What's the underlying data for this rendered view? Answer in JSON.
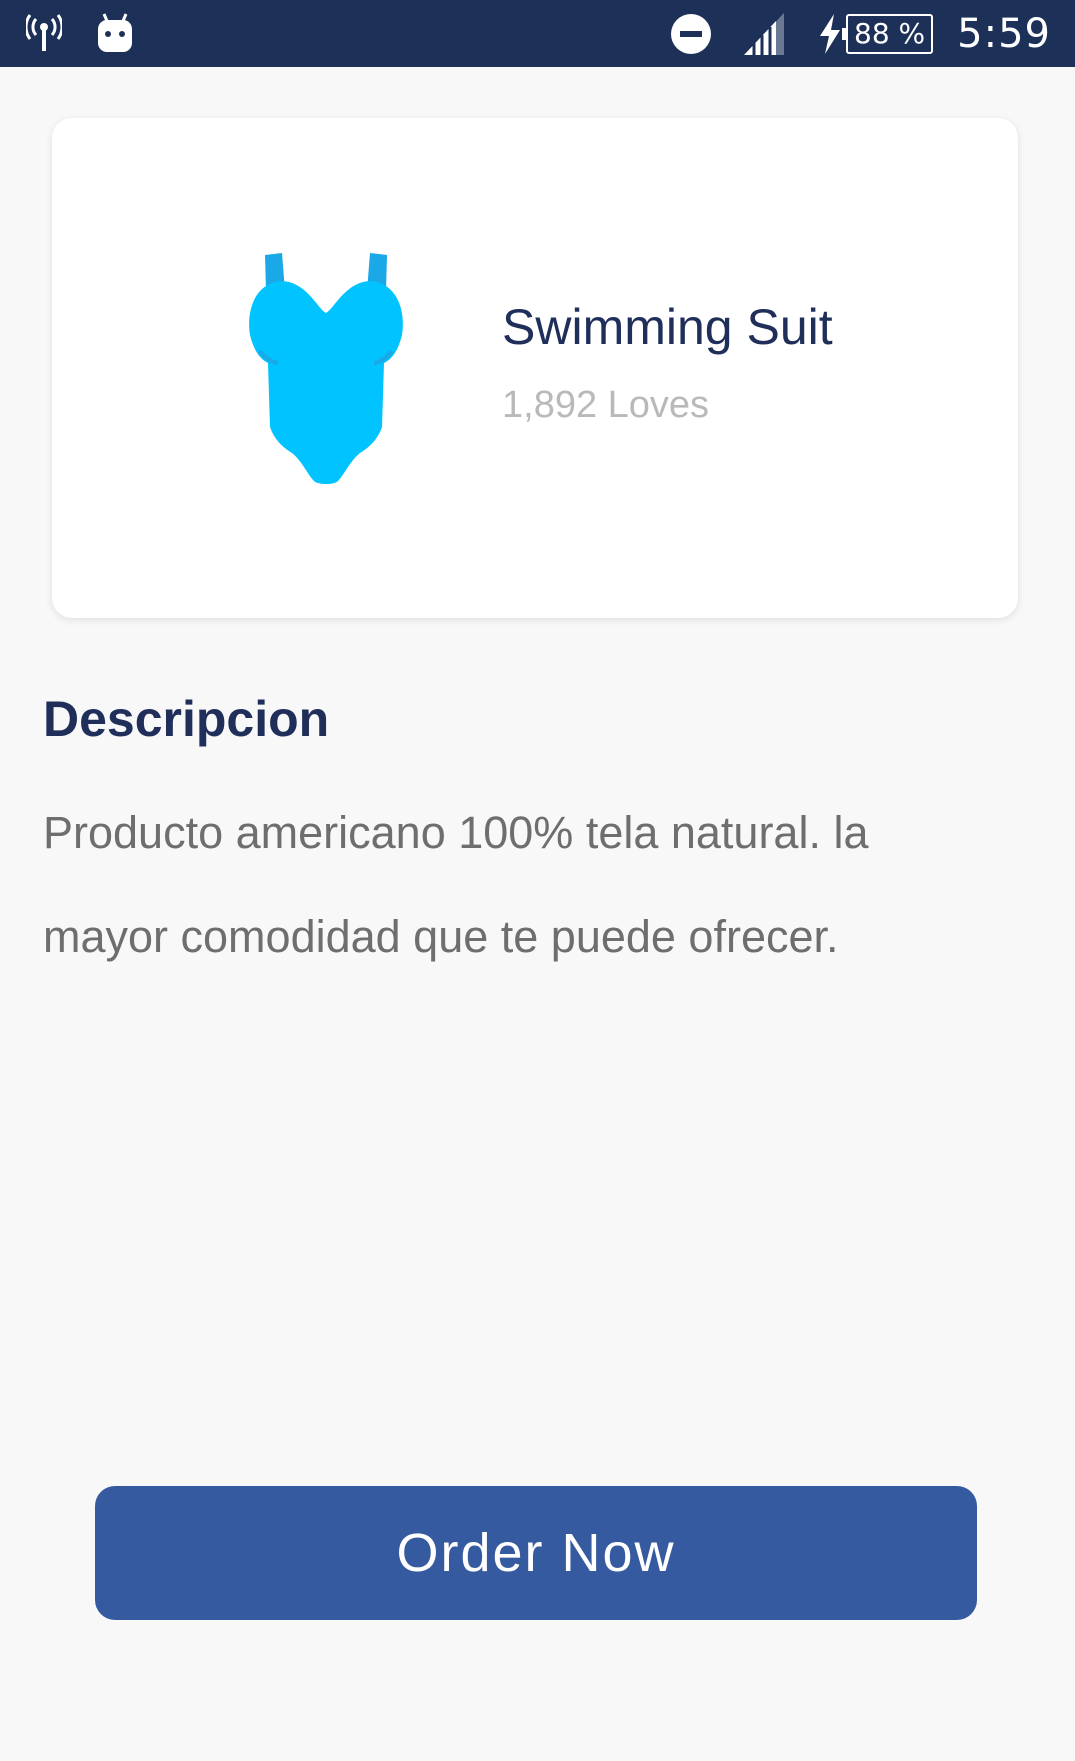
{
  "status_bar": {
    "battery_text": "88 %",
    "time": "5:59",
    "icons": [
      "wifi-hotspot-icon",
      "android-icon",
      "do-not-disturb-icon",
      "cell-signal-icon",
      "charging-bolt-icon"
    ]
  },
  "product": {
    "title": "Swimming Suit",
    "loves": "1,892 Loves",
    "icon": "swimsuit-icon",
    "icon_color": "#00c3ff"
  },
  "description": {
    "heading": "Descripcion",
    "body": "Producto americano 100% tela natural. la mayor comodidad que te puede ofrecer."
  },
  "actions": {
    "order_label": "Order Now"
  },
  "colors": {
    "status_bar": "#1d3158",
    "heading": "#1f2f5a",
    "button": "#365a9f",
    "background": "#f8f8f8"
  }
}
